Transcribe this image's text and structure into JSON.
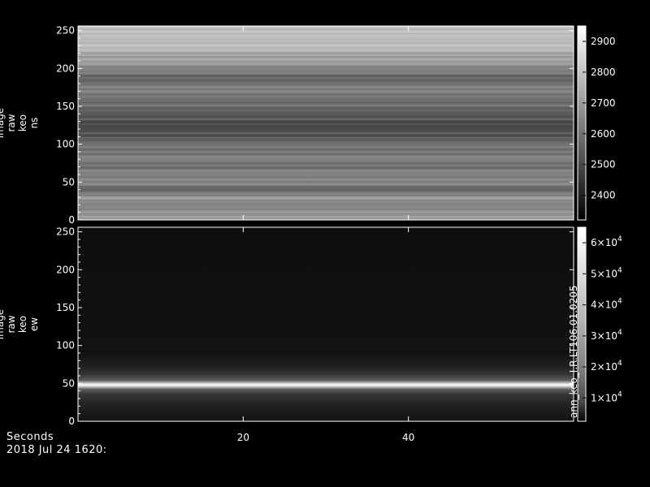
{
  "chart_data": [
    {
      "type": "heatmap",
      "ylabel_lines": [
        "image",
        "raw",
        "keo",
        "ns"
      ],
      "ylim": [
        0,
        256
      ],
      "yticks": [
        0,
        50,
        100,
        150,
        200,
        250
      ],
      "xlim": [
        0,
        60
      ],
      "colorbar": {
        "range": [
          2320,
          2950
        ],
        "ticks": [
          {
            "value": 2400,
            "label": "2400"
          },
          {
            "value": 2500,
            "label": "2500"
          },
          {
            "value": 2600,
            "label": "2600"
          },
          {
            "value": 2700,
            "label": "2700"
          },
          {
            "value": 2800,
            "label": "2800"
          },
          {
            "value": 2900,
            "label": "2900"
          }
        ]
      },
      "colormap": "grayscale",
      "profile_by_row": [
        {
          "y": 0,
          "value": 2700
        },
        {
          "y": 10,
          "value": 2680
        },
        {
          "y": 20,
          "value": 2640
        },
        {
          "y": 30,
          "value": 2700
        },
        {
          "y": 40,
          "value": 2560
        },
        {
          "y": 50,
          "value": 2660
        },
        {
          "y": 60,
          "value": 2640
        },
        {
          "y": 70,
          "value": 2600
        },
        {
          "y": 80,
          "value": 2640
        },
        {
          "y": 90,
          "value": 2620
        },
        {
          "y": 100,
          "value": 2600
        },
        {
          "y": 110,
          "value": 2540
        },
        {
          "y": 120,
          "value": 2500
        },
        {
          "y": 130,
          "value": 2520
        },
        {
          "y": 140,
          "value": 2540
        },
        {
          "y": 150,
          "value": 2580
        },
        {
          "y": 160,
          "value": 2600
        },
        {
          "y": 170,
          "value": 2640
        },
        {
          "y": 180,
          "value": 2600
        },
        {
          "y": 190,
          "value": 2560
        },
        {
          "y": 200,
          "value": 2660
        },
        {
          "y": 210,
          "value": 2720
        },
        {
          "y": 220,
          "value": 2760
        },
        {
          "y": 230,
          "value": 2800
        },
        {
          "y": 240,
          "value": 2780
        },
        {
          "y": 250,
          "value": 2800
        },
        {
          "y": 256,
          "value": 2820
        }
      ]
    },
    {
      "type": "heatmap",
      "ylabel_lines": [
        "image",
        "raw",
        "keo",
        "ew"
      ],
      "ylim": [
        0,
        256
      ],
      "yticks": [
        0,
        50,
        100,
        150,
        200,
        250
      ],
      "xlim": [
        0,
        60
      ],
      "colorbar": {
        "range": [
          2500,
          65000
        ],
        "ticks": [
          {
            "value": 10000,
            "mantissa": "1",
            "base": "×10",
            "exp": "4"
          },
          {
            "value": 20000,
            "mantissa": "2",
            "base": "×10",
            "exp": "4"
          },
          {
            "value": 30000,
            "mantissa": "3",
            "base": "×10",
            "exp": "4"
          },
          {
            "value": 40000,
            "mantissa": "4",
            "base": "×10",
            "exp": "4"
          },
          {
            "value": 50000,
            "mantissa": "5",
            "base": "×10",
            "exp": "4"
          },
          {
            "value": 60000,
            "mantissa": "6",
            "base": "×10",
            "exp": "4"
          }
        ]
      },
      "colormap": "grayscale",
      "side_label": "ann_keo_I.R.LT106.01.0205",
      "profile_by_row": [
        {
          "y": 0,
          "value": 3000
        },
        {
          "y": 20,
          "value": 4000
        },
        {
          "y": 35,
          "value": 6000
        },
        {
          "y": 42,
          "value": 12000
        },
        {
          "y": 46,
          "value": 45000
        },
        {
          "y": 48,
          "value": 65000
        },
        {
          "y": 50,
          "value": 45000
        },
        {
          "y": 54,
          "value": 12000
        },
        {
          "y": 62,
          "value": 6000
        },
        {
          "y": 72,
          "value": 4000
        },
        {
          "y": 90,
          "value": 3000
        },
        {
          "y": 256,
          "value": 2800
        }
      ]
    }
  ],
  "x_axis": {
    "ticks": [
      20,
      40
    ],
    "label": "Seconds",
    "date_label": "2018 Jul 24 1620:"
  }
}
